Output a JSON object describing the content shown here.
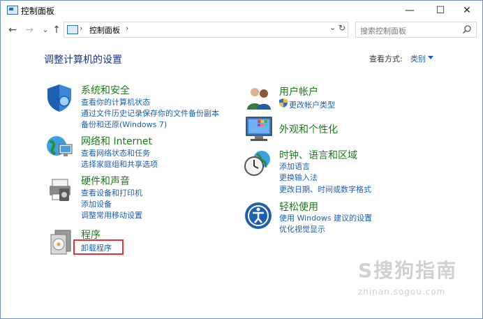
{
  "window": {
    "title": "控制面板"
  },
  "controls": {
    "minimize": "—",
    "maximize": "☐",
    "close": "✕"
  },
  "nav": {
    "back": "←",
    "forward": "→",
    "recent": "⌄",
    "up": "↑"
  },
  "address": {
    "path": "控制面板",
    "sep1": "›",
    "sep2": "›",
    "dropdown": "⌄",
    "refresh": "↻"
  },
  "search": {
    "placeholder": "搜索控制面板"
  },
  "main": {
    "heading": "调整计算机的设置",
    "view_by_label": "查看方式:",
    "view_by_value": "类别"
  },
  "categories": {
    "system": {
      "title": "系统和安全",
      "links": [
        "查看你的计算机状态",
        "通过文件历史记录保存你的文件备份副本",
        "备份和还原(Windows 7)"
      ]
    },
    "network": {
      "title": "网络和 Internet",
      "links": [
        "查看网络状态和任务",
        "选择家庭组和共享选项"
      ]
    },
    "hardware": {
      "title": "硬件和声音",
      "links": [
        "查看设备和打印机",
        "添加设备",
        "调整常用移动设置"
      ]
    },
    "programs": {
      "title": "程序",
      "links": [
        "卸载程序"
      ]
    },
    "user": {
      "title": "用户帐户",
      "links": [
        "更改帐户类型"
      ]
    },
    "appearance": {
      "title": "外观和个性化",
      "links": []
    },
    "clock": {
      "title": "时钟、语言和区域",
      "links": [
        "添加语言",
        "更换输入法",
        "更改日期、时间或数字格式"
      ]
    },
    "ease": {
      "title": "轻松使用",
      "links": [
        "使用 Windows 建议的设置",
        "优化视觉显示"
      ]
    }
  },
  "watermark": {
    "text": "S搜狗指南",
    "sub": "zhinan.sogou.com"
  },
  "colors": {
    "link": "#1a5fb4",
    "category": "#1b7a1b",
    "heading": "#1e3287",
    "highlight": "#e03232"
  }
}
